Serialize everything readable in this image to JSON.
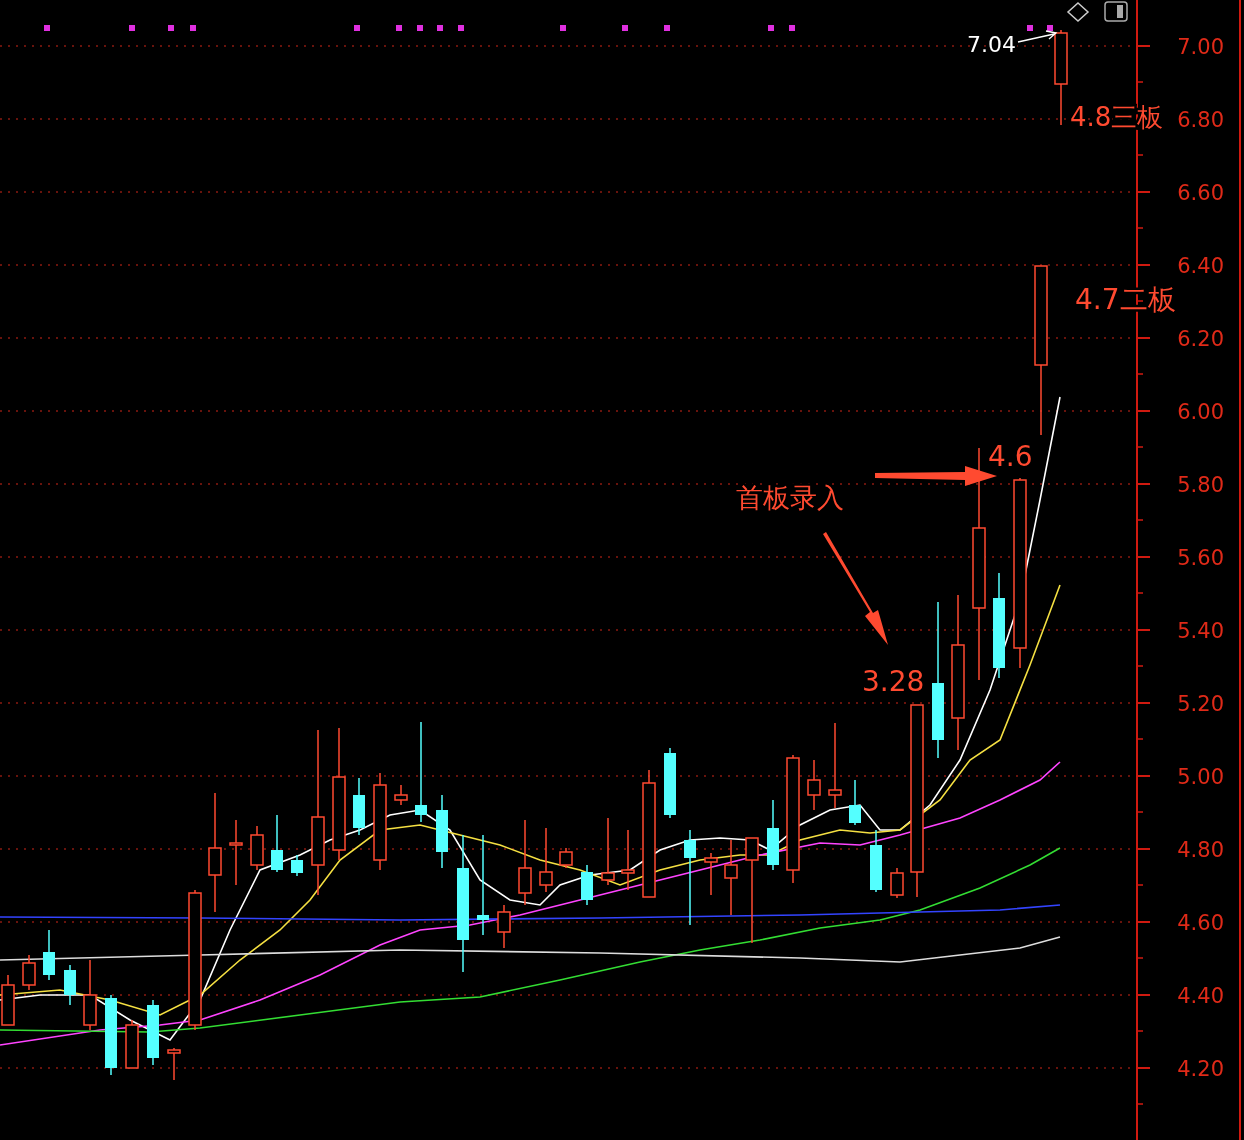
{
  "chart": {
    "price_axis": {
      "labels": [
        "7.00",
        "6.80",
        "6.60",
        "6.40",
        "6.20",
        "6.00",
        "5.80",
        "5.60",
        "5.40",
        "5.20",
        "5.00",
        "4.80",
        "4.60",
        "4.40",
        "4.20"
      ]
    },
    "annotations": [
      {
        "kind": "high",
        "text": "7.04"
      },
      {
        "kind": "note",
        "text": "4.8三板"
      },
      {
        "kind": "note",
        "text": "4.7二板"
      },
      {
        "kind": "note",
        "text": "4.6"
      },
      {
        "kind": "note",
        "text": "首板录入"
      },
      {
        "kind": "note",
        "text": "3.28"
      }
    ]
  }
}
